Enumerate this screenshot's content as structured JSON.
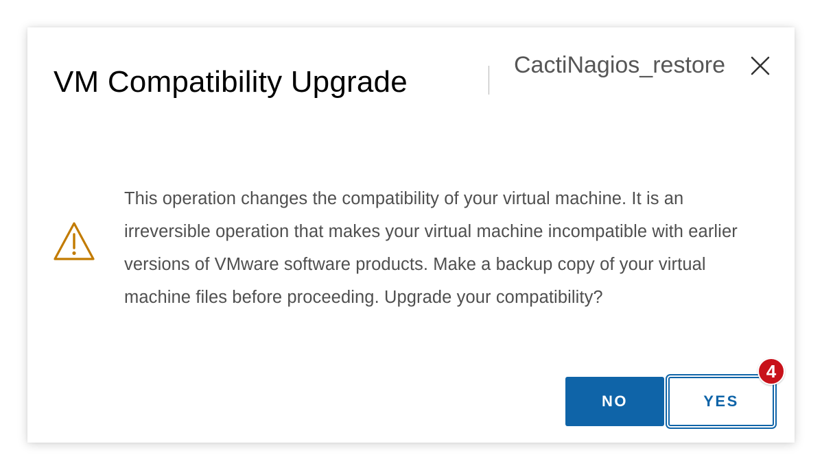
{
  "dialog": {
    "title": "VM Compatibility Upgrade",
    "subtitle": "CactiNagios_restore",
    "close_icon": "close-icon",
    "warning_icon": "warning-triangle-icon",
    "message": "This operation changes the compatibility of your virtual machine. It is an irreversible operation that makes your virtual machine incompatible with earlier versions of VMware software products. Make a backup copy of your virtual machine files before proceeding. Upgrade your compatibility?",
    "buttons": {
      "no_label": "NO",
      "yes_label": "YES"
    },
    "step_badge": "4"
  },
  "colors": {
    "primary": "#0f64a8",
    "warning": "#c27b00",
    "badge": "#c8121a"
  }
}
